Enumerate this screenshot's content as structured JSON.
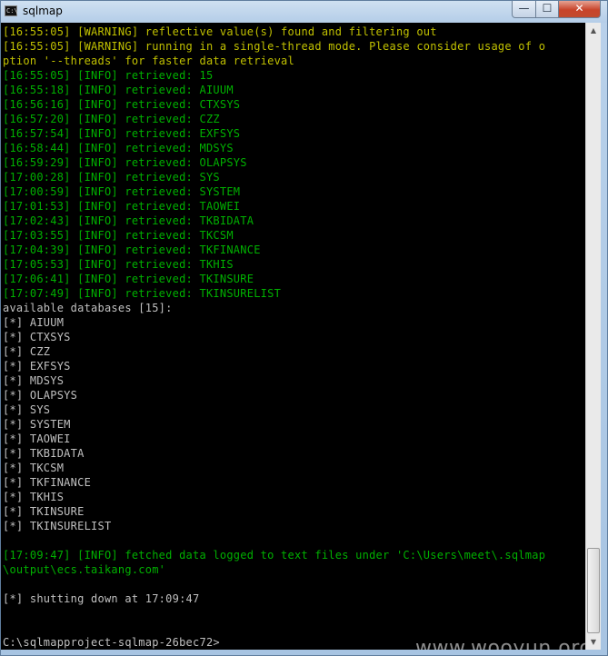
{
  "window": {
    "title": "sqlmap",
    "icon_text": "C:\\",
    "minimize_glyph": "—",
    "maximize_glyph": "☐",
    "close_glyph": "✕"
  },
  "colors": {
    "warning": "#c0c000",
    "info": "#00b000",
    "plain": "#c0c0c0",
    "background": "#000000"
  },
  "console": {
    "lines": [
      {
        "text": "[16:55:05] [WARNING] reflective value(s) found and filtering out",
        "style": "yellow"
      },
      {
        "text": "[16:55:05] [WARNING] running in a single-thread mode. Please consider usage of o",
        "style": "yellow"
      },
      {
        "text": "ption '--threads' for faster data retrieval",
        "style": "yellow"
      },
      {
        "text": "[16:55:05] [INFO] retrieved: 15",
        "style": "green"
      },
      {
        "text": "[16:55:18] [INFO] retrieved: AIUUM",
        "style": "green"
      },
      {
        "text": "[16:56:16] [INFO] retrieved: CTXSYS",
        "style": "green"
      },
      {
        "text": "[16:57:20] [INFO] retrieved: CZZ",
        "style": "green"
      },
      {
        "text": "[16:57:54] [INFO] retrieved: EXFSYS",
        "style": "green"
      },
      {
        "text": "[16:58:44] [INFO] retrieved: MDSYS",
        "style": "green"
      },
      {
        "text": "[16:59:29] [INFO] retrieved: OLAPSYS",
        "style": "green"
      },
      {
        "text": "[17:00:28] [INFO] retrieved: SYS",
        "style": "green"
      },
      {
        "text": "[17:00:59] [INFO] retrieved: SYSTEM",
        "style": "green"
      },
      {
        "text": "[17:01:53] [INFO] retrieved: TAOWEI",
        "style": "green"
      },
      {
        "text": "[17:02:43] [INFO] retrieved: TKBIDATA",
        "style": "green"
      },
      {
        "text": "[17:03:55] [INFO] retrieved: TKCSM",
        "style": "green"
      },
      {
        "text": "[17:04:39] [INFO] retrieved: TKFINANCE",
        "style": "green"
      },
      {
        "text": "[17:05:53] [INFO] retrieved: TKHIS",
        "style": "green"
      },
      {
        "text": "[17:06:41] [INFO] retrieved: TKINSURE",
        "style": "green"
      },
      {
        "text": "[17:07:49] [INFO] retrieved: TKINSURELIST",
        "style": "green"
      },
      {
        "text": "available databases [15]:",
        "style": "white"
      },
      {
        "text": "[*] AIUUM",
        "style": "white"
      },
      {
        "text": "[*] CTXSYS",
        "style": "white"
      },
      {
        "text": "[*] CZZ",
        "style": "white"
      },
      {
        "text": "[*] EXFSYS",
        "style": "white"
      },
      {
        "text": "[*] MDSYS",
        "style": "white"
      },
      {
        "text": "[*] OLAPSYS",
        "style": "white"
      },
      {
        "text": "[*] SYS",
        "style": "white"
      },
      {
        "text": "[*] SYSTEM",
        "style": "white"
      },
      {
        "text": "[*] TAOWEI",
        "style": "white"
      },
      {
        "text": "[*] TKBIDATA",
        "style": "white"
      },
      {
        "text": "[*] TKCSM",
        "style": "white"
      },
      {
        "text": "[*] TKFINANCE",
        "style": "white"
      },
      {
        "text": "[*] TKHIS",
        "style": "white"
      },
      {
        "text": "[*] TKINSURE",
        "style": "white"
      },
      {
        "text": "[*] TKINSURELIST",
        "style": "white"
      },
      {
        "text": "",
        "style": "white"
      },
      {
        "text": "[17:09:47] [INFO] fetched data logged to text files under 'C:\\Users\\meet\\.sqlmap",
        "style": "green"
      },
      {
        "text": "\\output\\ecs.taikang.com'",
        "style": "green"
      },
      {
        "text": "",
        "style": "white"
      },
      {
        "text": "[*] shutting down at 17:09:47",
        "style": "white"
      },
      {
        "text": "",
        "style": "white"
      },
      {
        "text": "",
        "style": "white"
      },
      {
        "text": "C:\\sqlmapproject-sqlmap-26bec72>",
        "style": "white"
      }
    ]
  },
  "scrollbar": {
    "up_arrow": "▲",
    "down_arrow": "▼"
  },
  "watermark": "www.wooyun.org"
}
